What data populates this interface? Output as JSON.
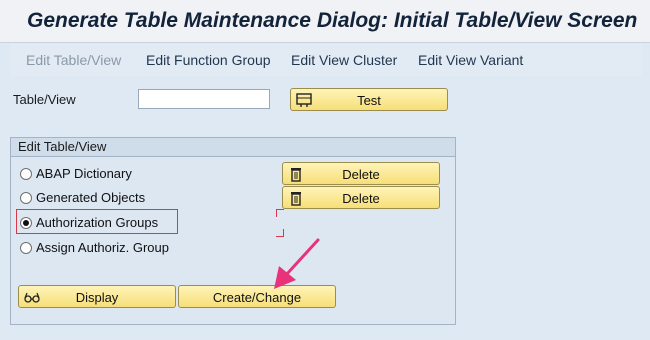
{
  "window": {
    "title": "Generate Table Maintenance Dialog: Initial Table/View Screen"
  },
  "menu": [
    "Edit Table/View",
    "Edit Function Group",
    "Edit View Cluster",
    "Edit View Variant"
  ],
  "table_view": {
    "label": "Table/View",
    "value": ""
  },
  "test_button": {
    "label": "Test",
    "icon": "test-icon"
  },
  "edit_group": {
    "title": "Edit Table/View",
    "options": [
      {
        "label": "ABAP Dictionary",
        "selected": false
      },
      {
        "label": "Generated Objects",
        "selected": false
      },
      {
        "label": "Authorization Groups",
        "selected": true
      },
      {
        "label": "Assign Authoriz. Group",
        "selected": false
      }
    ],
    "delete_label": "Delete",
    "display_label": "Display",
    "create_change_label": "Create/Change"
  },
  "colors": {
    "highlight": "#d63a4a",
    "arrow": "#e8337a",
    "button": "#f6df78"
  }
}
